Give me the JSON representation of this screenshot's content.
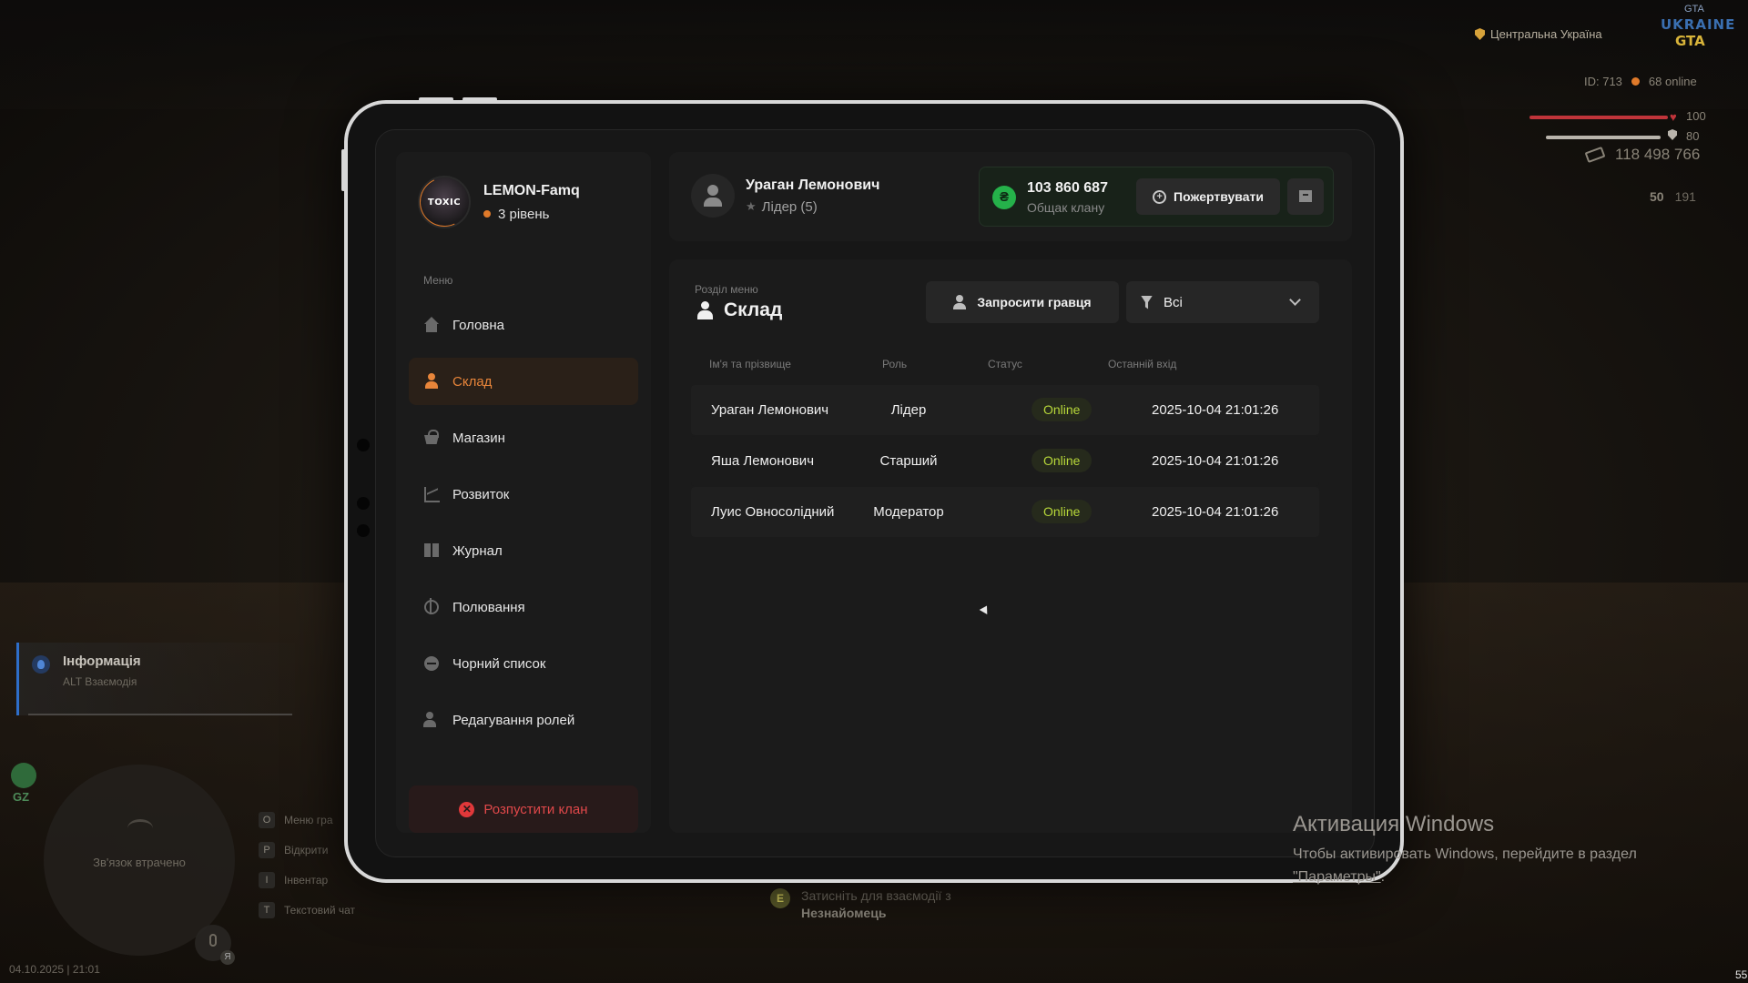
{
  "hud": {
    "region": "Центральна Україна",
    "logo_top": "GTA",
    "logo_line1": "UKRAINE",
    "logo_line2": "GTA",
    "player_id": "ID: 713",
    "online": "68 online",
    "health": "100",
    "armor": "80",
    "money": "118 498 766",
    "ammo_clip": "50",
    "ammo_total": "191",
    "notification": {
      "title": "Інформація",
      "subtitle": "ALT Взаємодія"
    },
    "gz": "GZ",
    "minimap_text": "Зв'язок втрачено",
    "voice_key": "Я",
    "keys": [
      {
        "key": "O",
        "label": "Меню гра"
      },
      {
        "key": "P",
        "label": "Відкрити"
      },
      {
        "key": "I",
        "label": "Інвентар"
      },
      {
        "key": "T",
        "label": "Текстовий чат"
      }
    ],
    "datetime": "04.10.2025 | 21:01",
    "corner_num": "55",
    "prompt": {
      "key": "E",
      "line1": "Затисніть для взаємодії з",
      "line2": "Незнайомець"
    }
  },
  "windows": {
    "title": "Активация Windows",
    "line1": "Чтобы активировать Windows, перейдите в раздел",
    "link": "\"Параметры\"",
    "dot": "."
  },
  "clan": {
    "logo_text": "TOXIC",
    "name": "LEMON-Famq",
    "level": "3 рівень"
  },
  "menu": {
    "title": "Меню",
    "items": [
      {
        "label": "Головна",
        "icon": "home-icon"
      },
      {
        "label": "Склад",
        "icon": "people-icon",
        "active": true
      },
      {
        "label": "Магазин",
        "icon": "basket-icon"
      },
      {
        "label": "Розвиток",
        "icon": "chart-icon"
      },
      {
        "label": "Журнал",
        "icon": "book-icon"
      },
      {
        "label": "Полювання",
        "icon": "target-icon"
      },
      {
        "label": "Чорний список",
        "icon": "block-icon"
      },
      {
        "label": "Редагування ролей",
        "icon": "user-edit-icon"
      }
    ],
    "disband": "Розпустити клан"
  },
  "user": {
    "name": "Ураган Лемонович",
    "role": "Лідер (5)"
  },
  "treasury": {
    "currency_symbol": "₴",
    "amount": "103 860 687",
    "label": "Общак клану",
    "donate": "Пожертвувати"
  },
  "section": {
    "small": "Розділ меню",
    "title": "Склад",
    "invite": "Запросити гравця",
    "filter": "Всі"
  },
  "table": {
    "headers": [
      "Ім'я та прізвище",
      "Роль",
      "Статус",
      "Останній вхід"
    ],
    "rows": [
      {
        "name": "Ураган Лемонович",
        "role": "Лідер",
        "status": "Online",
        "last": "2025-10-04 21:01:26"
      },
      {
        "name": "Яша Лемонович",
        "role": "Старший",
        "status": "Online",
        "last": "2025-10-04 21:01:26"
      },
      {
        "name": "Луис Овносолідний",
        "role": "Модератор",
        "status": "Online",
        "last": "2025-10-04 21:01:26"
      }
    ]
  }
}
